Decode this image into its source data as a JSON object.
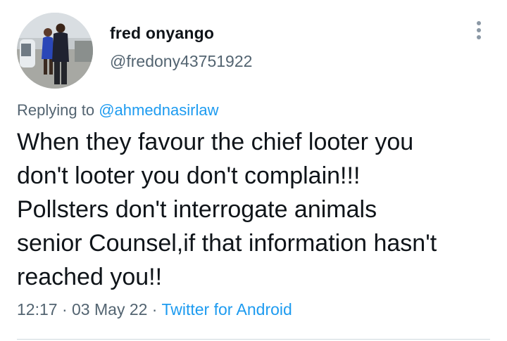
{
  "author": {
    "display_name": "fred onyango",
    "handle": "@fredony43751922"
  },
  "reply": {
    "prefix": "Replying to ",
    "mention": "@ahmednasirlaw"
  },
  "tweet": {
    "text": "When they favour the chief looter you\ndon't looter you don't complain!!!\nPollsters don't interrogate animals\nsenior Counsel,if that information hasn't\nreached you!!",
    "time": "12:17",
    "separator": " · ",
    "date": "03 May 22",
    "source": "Twitter for Android"
  },
  "icons": {
    "more": "more-vertical-icon",
    "avatar": "profile-photo"
  },
  "colors": {
    "accent": "#1d9bf0",
    "text_primary": "#0f1419",
    "text_secondary": "#536471",
    "divider": "#cfd9de"
  }
}
